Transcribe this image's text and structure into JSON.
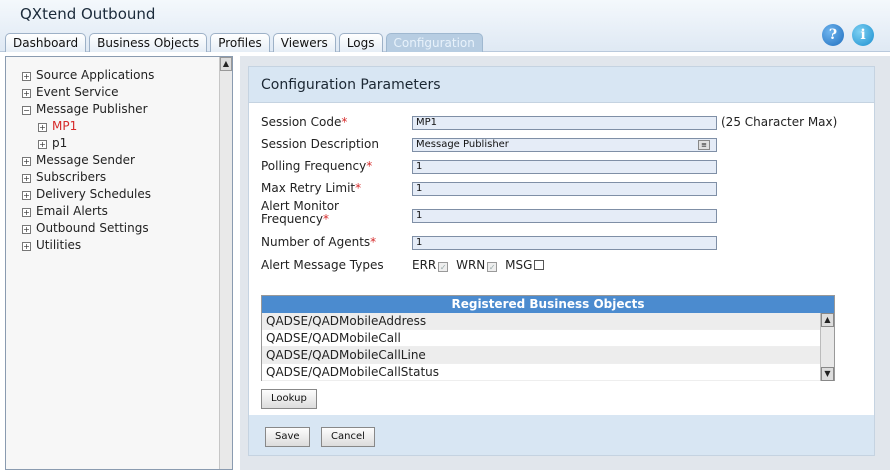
{
  "app": {
    "title": "QXtend Outbound"
  },
  "tabs": [
    "Dashboard",
    "Business Objects",
    "Profiles",
    "Viewers",
    "Logs",
    "Configuration"
  ],
  "header_icons": {
    "help": "?",
    "info": "i"
  },
  "tree": [
    {
      "label": "Source Applications",
      "expander": "+"
    },
    {
      "label": "Event Service",
      "expander": "+"
    },
    {
      "label": "Message Publisher",
      "expander": "−"
    },
    {
      "label": "MP1",
      "expander": "+"
    },
    {
      "label": "p1",
      "expander": "+"
    },
    {
      "label": "Message Sender",
      "expander": "+"
    },
    {
      "label": "Subscribers",
      "expander": "+"
    },
    {
      "label": "Delivery Schedules",
      "expander": "+"
    },
    {
      "label": "Email Alerts",
      "expander": "+"
    },
    {
      "label": "Outbound Settings",
      "expander": "+"
    },
    {
      "label": "Utilities",
      "expander": "+"
    }
  ],
  "panel": {
    "title": "Configuration Parameters"
  },
  "form": {
    "session_code": {
      "label": "Session Code",
      "value": "MP1",
      "note": "(25 Character Max)"
    },
    "session_description": {
      "label": "Session Description",
      "value": "Message Publisher"
    },
    "polling_frequency": {
      "label": "Polling Frequency",
      "value": "1"
    },
    "max_retry_limit": {
      "label": "Max Retry Limit",
      "value": "1"
    },
    "alert_monitor_frequency": {
      "label_line1": "Alert Monitor",
      "label_line2": "Frequency",
      "value": "1"
    },
    "number_of_agents": {
      "label": "Number of Agents",
      "value": "1"
    },
    "alert_message_types": {
      "label": "Alert Message Types",
      "err": "ERR",
      "wrn": "WRN",
      "msg": "MSG"
    },
    "required_mark": "*",
    "check_mark": "✓"
  },
  "business_objects": {
    "header": "Registered Business Objects",
    "rows": [
      "QADSE/QADMobileAddress",
      "QADSE/QADMobileCall",
      "QADSE/QADMobileCallLine",
      "QADSE/QADMobileCallStatus"
    ],
    "scroll_up": "▲",
    "scroll_down": "▼"
  },
  "buttons": {
    "lookup": "Lookup",
    "save": "Save",
    "cancel": "Cancel"
  },
  "sidebar_scroll_up": "▲"
}
